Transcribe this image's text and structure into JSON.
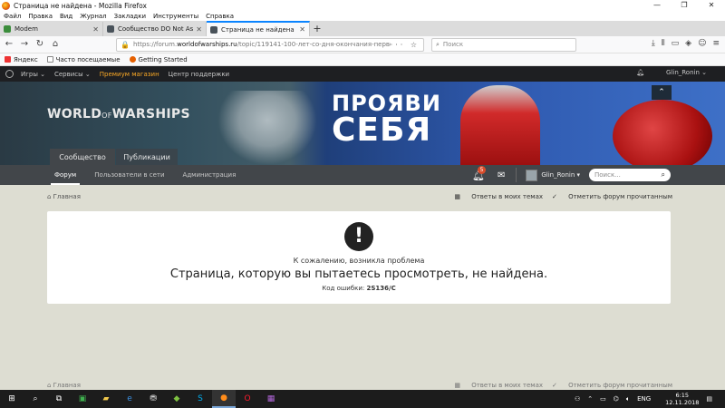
{
  "window": {
    "title": "Страница не найдена - Mozilla Firefox",
    "controls": [
      "—",
      "❐",
      "✕"
    ]
  },
  "menu": [
    "Файл",
    "Правка",
    "Вид",
    "Журнал",
    "Закладки",
    "Инструменты",
    "Справка"
  ],
  "tabs": [
    {
      "label": "Modem",
      "color": "#3b8d3b"
    },
    {
      "label": "Сообщество DO Not Ask for T",
      "color": "#49525a"
    },
    {
      "label": "Страница не найдена",
      "color": "#49525a",
      "active": true
    }
  ],
  "nav": {
    "url_scheme": "https://forum.",
    "url_host": "worldofwarships.ru",
    "url_path": "/topic/119141-100-лет-со-дня-окончания-первой-ми",
    "url_icons": "··· ☆",
    "search_placeholder": "Поиск"
  },
  "bookmarks": [
    {
      "label": "Яндекс",
      "color": "#e33"
    },
    {
      "label": "Часто посещаемые",
      "color": "#fff"
    },
    {
      "label": "Getting Started",
      "color": "#e66000"
    }
  ],
  "site_nav": {
    "items": [
      "Игры ⌄",
      "Сервисы ⌄",
      "Премиум магазин",
      "Центр поддержки"
    ],
    "user": "Glin_Ronin ⌄"
  },
  "banner": {
    "logo_a": "WORLD",
    "logo_of": "OF",
    "logo_b": "WARSHIPS",
    "slogan_1": "ПРОЯВИ",
    "slogan_2": "СЕБЯ",
    "scroll_top": "⌃",
    "community_tab": "Сообщество",
    "publications_tab": "Публикации"
  },
  "sub_nav": {
    "items": [
      "Форум",
      "Пользователи в сети",
      "Администрация"
    ],
    "notification_count": "5",
    "user": "Glin_Ronin ▾",
    "search_placeholder": "Поиск...",
    "search_icon": "🔍"
  },
  "breadcrumb": {
    "home": "Главная",
    "action_1": "Ответы в моих темах",
    "action_2": "Отметить форум прочитанным"
  },
  "error": {
    "icon": "!",
    "line1": "К сожалению, возникла проблема",
    "line2": "Страница, которую вы пытаетесь просмотреть, не найдена.",
    "code_label": "Код ошибки:",
    "code": "2S136/C"
  },
  "taskbar": {
    "lang": "ENG",
    "time": "6:15",
    "date": "12.11.2018"
  }
}
